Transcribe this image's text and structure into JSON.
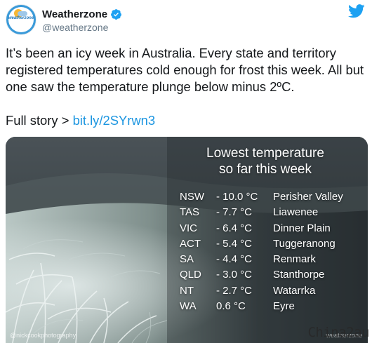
{
  "author": {
    "display_name": "Weatherzone",
    "handle": "@weatherzone",
    "avatar_text": "weatherzone"
  },
  "icons": {
    "verified": "verified-badge-icon",
    "brand": "twitter-bird-icon"
  },
  "colors": {
    "link": "#1b95e0",
    "verified": "#1da1f2",
    "brand": "#1da1f2"
  },
  "tweet": {
    "text": "It’s been an icy week in Australia. Every state and territory registered temperatures cold enough for frost this week. All but one saw the temperature plunge below minus 2ºC.",
    "full_story_label": "Full story > ",
    "link_text": "bit.ly/2SYrwn3"
  },
  "media": {
    "title_line1": "Lowest temperature",
    "title_line2": "so far this week",
    "rows": [
      {
        "state": "NSW",
        "temp": "- 10.0 °C",
        "place": "Perisher Valley"
      },
      {
        "state": "TAS",
        "temp": "- 7.7 °C",
        "place": "Liawenee"
      },
      {
        "state": "VIC",
        "temp": "- 6.4 °C",
        "place": "Dinner Plain"
      },
      {
        "state": "ACT",
        "temp": "- 5.4 °C",
        "place": "Tuggeranong"
      },
      {
        "state": "SA",
        "temp": "- 4.4 °C",
        "place": "Renmark"
      },
      {
        "state": "QLD",
        "temp": "- 3.0 °C",
        "place": "Stanthorpe"
      },
      {
        "state": "NT",
        "temp": "- 2.7 °C",
        "place": "Watarrka"
      },
      {
        "state": "WA",
        "temp": "0.6 °C",
        "place": "Eyre"
      }
    ],
    "credit_left": "@nickcookphotography",
    "credit_right": "weatherzone"
  },
  "watermark": "China2au"
}
